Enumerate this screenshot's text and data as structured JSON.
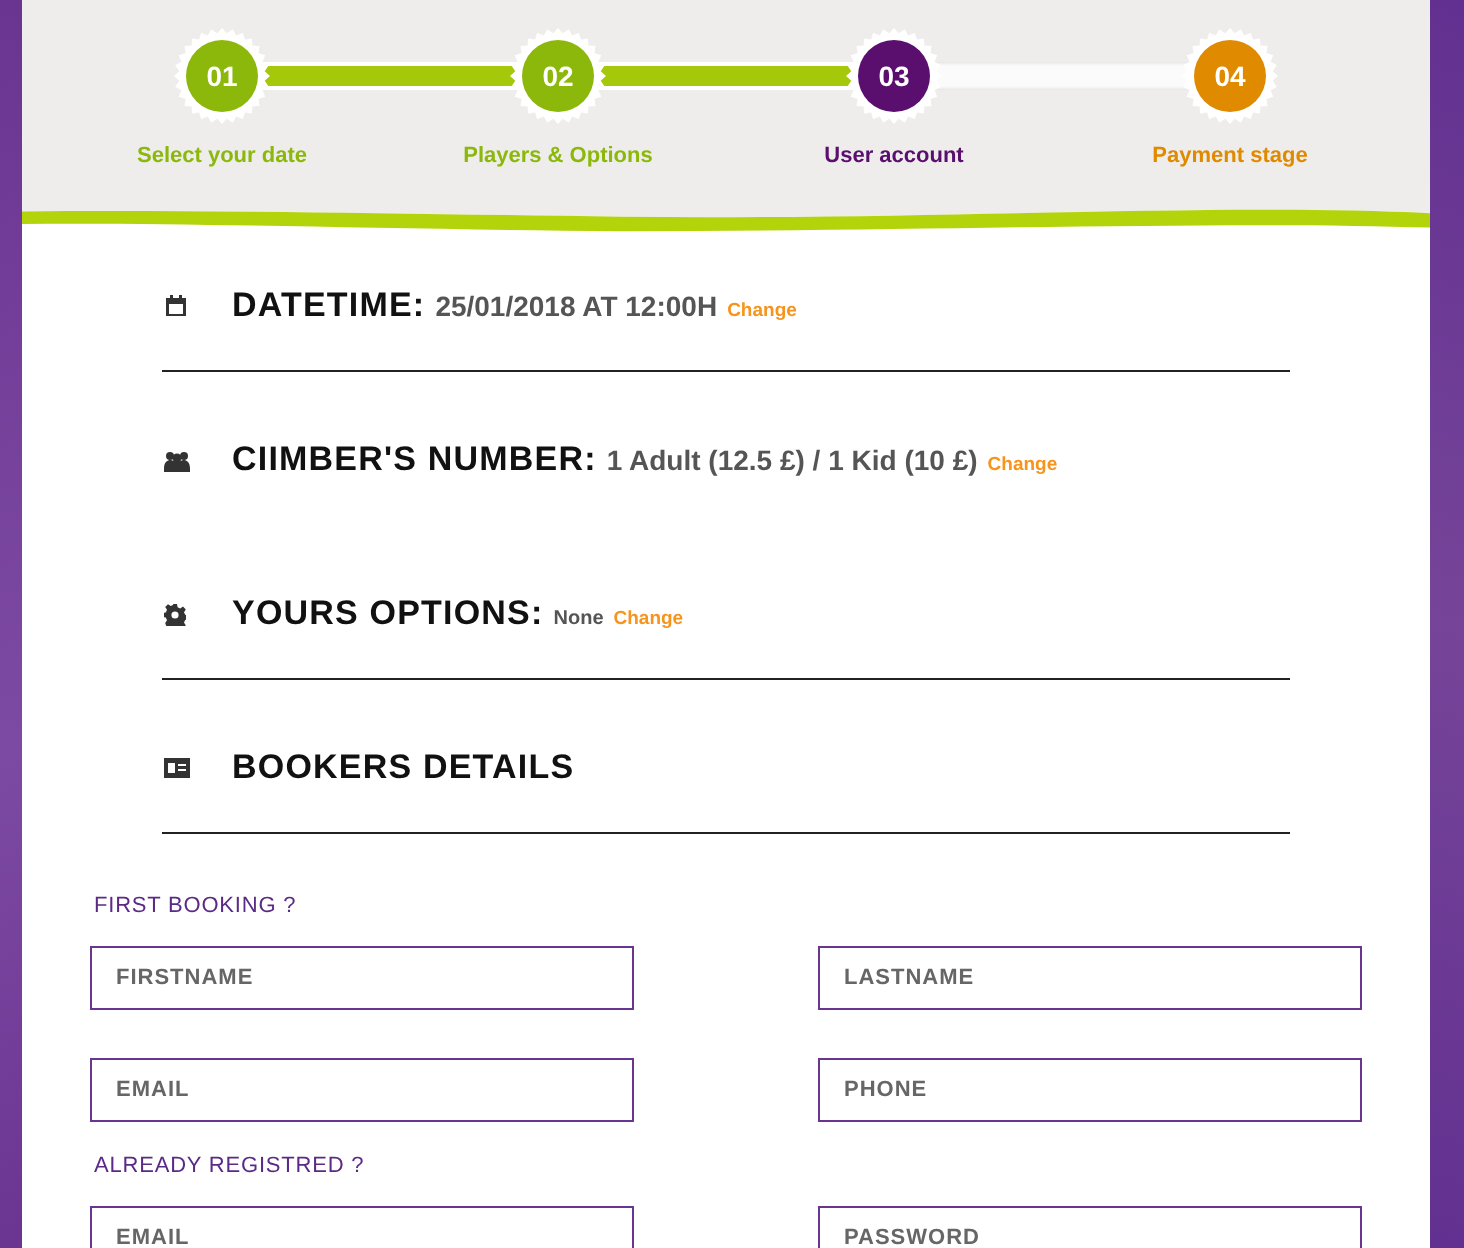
{
  "steps": [
    {
      "number": "01",
      "label": "Select your date",
      "color": "#8cb80c"
    },
    {
      "number": "02",
      "label": "Players & Options",
      "color": "#8cb80c"
    },
    {
      "number": "03",
      "label": "User account",
      "color": "#5a0f6e"
    },
    {
      "number": "04",
      "label": "Payment stage",
      "color": "#e08a00"
    }
  ],
  "connectors": [
    {
      "completed": true
    },
    {
      "completed": true
    },
    {
      "completed": false
    }
  ],
  "summary": [
    {
      "kind": "calendar",
      "title": "DATETIME:",
      "value": "25/01/2018 AT 12:00H",
      "value_small": false,
      "link": "Change",
      "divider": true
    },
    {
      "kind": "people",
      "title": "CIIMBER'S NUMBER:",
      "value": "1  Adult (12.5 £) / 1  Kid (10 £)",
      "value_small": false,
      "link": "Change",
      "divider": false
    },
    {
      "kind": "gear",
      "title": "YOURS OPTIONS:",
      "value": "None",
      "value_small": true,
      "link": "Change",
      "divider": true
    },
    {
      "kind": "card",
      "title": "BOOKERS DETAILS",
      "divider": true
    }
  ],
  "form_groups": [
    {
      "label": "FIRST BOOKING ?",
      "fields": [
        {
          "placeholder": "FIRSTNAME"
        },
        {
          "placeholder": "LASTNAME"
        },
        {
          "placeholder": "EMAIL"
        },
        {
          "placeholder": "PHONE"
        }
      ]
    },
    {
      "label": "ALREADY REGISTRED ?",
      "fields": [
        {
          "placeholder": "EMAIL"
        },
        {
          "placeholder": "PASSWORD"
        }
      ]
    }
  ]
}
